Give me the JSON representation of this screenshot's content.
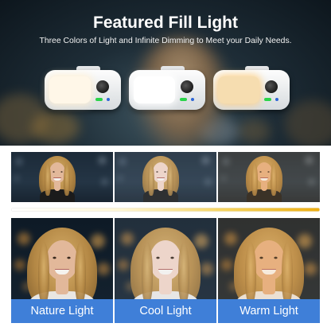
{
  "header": {
    "title": "Featured Fill Light",
    "subtitle": "Three Colors of Light and Infinite Dimming to Meet your Daily Needs."
  },
  "lamps": [
    {
      "panel_color": "#fff7e8",
      "led_color": "#2bd44a",
      "glow": "#fff1d6"
    },
    {
      "panel_color": "#ffffff",
      "led_color": "#2bd44a",
      "glow": "#ffffff"
    },
    {
      "panel_color": "#f6ddb0",
      "led_color": "#2bd44a",
      "glow": "#ffd28a"
    }
  ],
  "modes": [
    {
      "label": "Nature Light",
      "skin": "#e2b89a",
      "tint": "rgba(255,255,255,0)"
    },
    {
      "label": "Cool Light",
      "skin": "#f0d3c4",
      "tint": "rgba(220,235,255,0.10)"
    },
    {
      "label": "Warm Light",
      "skin": "#e3ae82",
      "tint": "rgba(255,190,110,0.14)"
    }
  ],
  "colors": {
    "label_bar": "#3f7fd8",
    "slider_start": "#ffffff",
    "slider_end": "#eeaf12"
  },
  "icons": [
    "fill-light-lamp-icon",
    "dial-knob-icon",
    "power-led-icon"
  ]
}
